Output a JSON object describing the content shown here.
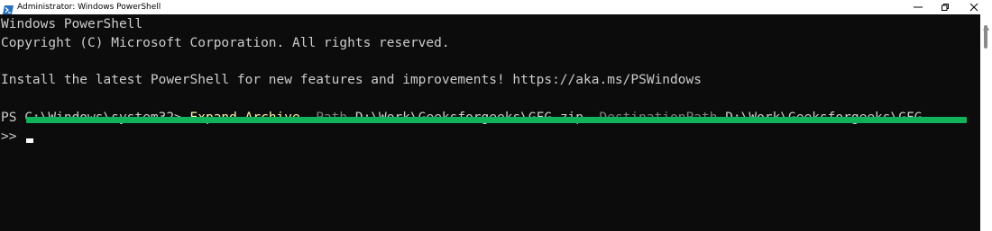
{
  "window": {
    "title": "Administrator: Windows PowerShell",
    "icon": "powershell-icon",
    "controls": [
      "minimize-icon",
      "restore-icon",
      "close-icon"
    ]
  },
  "console": {
    "lines": [
      "Windows PowerShell",
      "Copyright (C) Microsoft Corporation. All rights reserved.",
      "",
      "Install the latest PowerShell for new features and improvements! https://aka.ms/PSWindows",
      ""
    ],
    "prompt": "PS C:\\Windows\\system32> ",
    "command": {
      "cmdlet": "Expand-Archive",
      "param1": "-Path",
      "value1": "D:\\Work\\Geeksforgeeks\\GFG.zip",
      "param2": "-DestinationPath",
      "value2": "D:\\Work\\Geeksforgeeks\\GFG"
    },
    "continuation_prompt": ">>",
    "progress": 1.0
  },
  "colors": {
    "background": "#0c0c0c",
    "text": "#cccccc",
    "cmdlet": "#f9f1a5",
    "parameter": "#808080",
    "progress": "#10b359"
  }
}
